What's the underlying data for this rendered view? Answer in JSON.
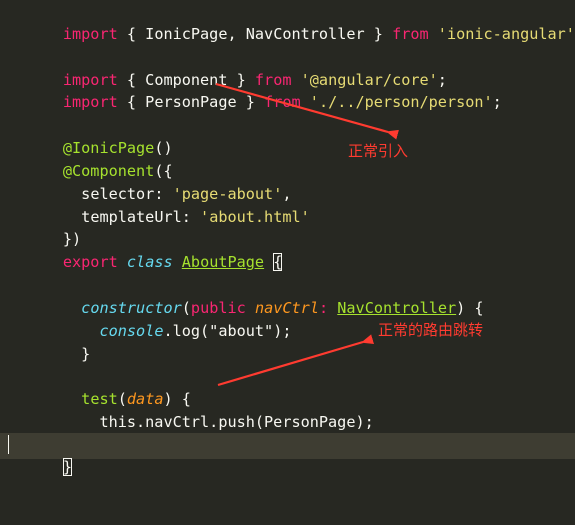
{
  "code_lines": {
    "l1": {
      "kw": "import",
      "a": " { IonicPage, NavController } ",
      "kw2": "from",
      "sp": " ",
      "str": "'ionic-angular'",
      "end": ";"
    },
    "l3": {
      "kw": "import",
      "a": " { Component } ",
      "kw2": "from",
      "sp": " ",
      "str": "'@angular/core'",
      "end": ";"
    },
    "l4": {
      "kw": "import",
      "a": " { PersonPage } ",
      "kw2": "from",
      "sp": " ",
      "str": "'./../person/person'",
      "end": ";"
    },
    "l6": {
      "dec": "@IonicPage",
      "rest": "()"
    },
    "l7": {
      "dec": "@Component",
      "rest": "({"
    },
    "l8": {
      "indent": "  ",
      "key": "selector: ",
      "str": "'page-about'",
      "end": ","
    },
    "l9": {
      "indent": "  ",
      "key": "templateUrl: ",
      "str": "'about.html'"
    },
    "l10": {
      "text": "})"
    },
    "l11": {
      "kw": "export",
      "sp": " ",
      "storage": "class",
      "sp2": " ",
      "cls": "AboutPage",
      "sp3": " ",
      "brace": "{"
    },
    "l13": {
      "indent": "  ",
      "ctor": "constructor",
      "p1": "(",
      "mod": "public",
      "sp": " ",
      "param": "navCtrl",
      "colon": ": ",
      "type": "NavController",
      "end": ") {"
    },
    "l14": {
      "indent": "    ",
      "obj": "console",
      "rest": ".log(\"about\");"
    },
    "l15": {
      "text": "  }"
    },
    "l17": {
      "indent": "  ",
      "fn": "test",
      "p1": "(",
      "param": "data",
      "end": ") {"
    },
    "l18": {
      "text": "    this.navCtrl.push(PersonPage);"
    },
    "l19": {
      "text": "  }"
    },
    "l20": {
      "brace": "}"
    }
  },
  "annotations": {
    "normal_import": "正常引入",
    "normal_routing": "正常的路由跳转"
  },
  "colors": {
    "background": "#272822",
    "keyword": "#f92672",
    "string": "#e6db74",
    "function": "#a6e22e",
    "storage": "#66d9ef",
    "parameter": "#fd971f",
    "annotation": "#ff3b30",
    "current_line": "#3e3d32"
  }
}
